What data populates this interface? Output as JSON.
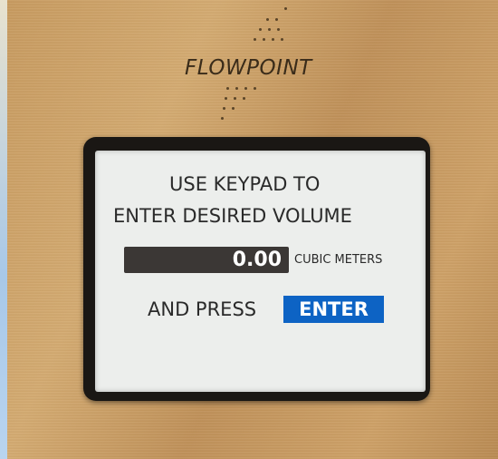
{
  "device": {
    "brand": "FLOWPOINT"
  },
  "screen": {
    "instruction_line1": "USE KEYPAD TO",
    "instruction_line2": "ENTER DESIRED VOLUME",
    "volume_value": "0.00",
    "volume_unit": "CUBIC METERS",
    "press_text": "AND PRESS",
    "enter_label": "ENTER"
  },
  "colors": {
    "panel": "#c99c62",
    "bezel": "#1a1714",
    "screen_background": "#eceeec",
    "value_field": "#3b3735",
    "enter_highlight": "#0d63c4"
  }
}
